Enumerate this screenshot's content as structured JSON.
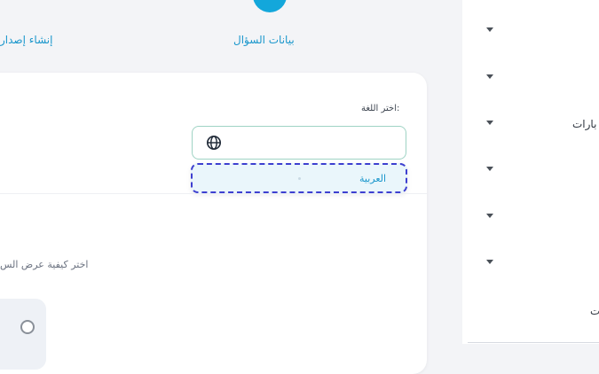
{
  "steps": {
    "question_data": "بيانات السؤال",
    "create_version": "إنشاء إصدار"
  },
  "language": {
    "label": "اختر اللغة:",
    "selected_option": "العربية",
    "icon": "globe-icon"
  },
  "display": {
    "label": "اختر كيفية عرض الس"
  },
  "sidebar": {
    "item_1": "بارات",
    "item_2": "ت"
  },
  "colors": {
    "accent": "#13a7db",
    "focus_outline": "#3d3fd0"
  }
}
